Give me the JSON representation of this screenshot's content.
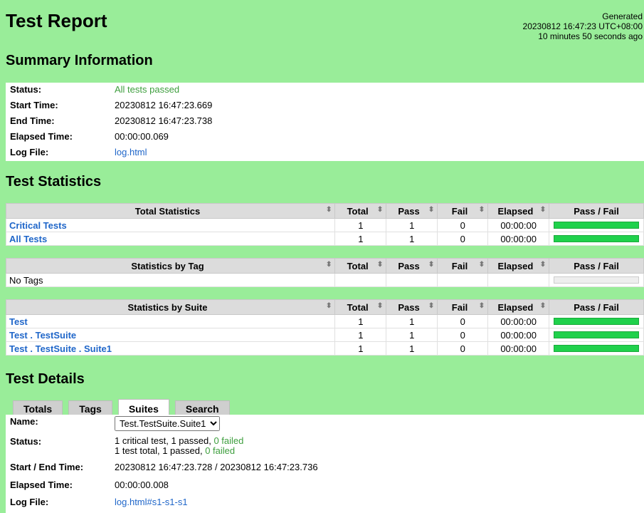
{
  "header": {
    "title": "Test Report",
    "generated_label": "Generated",
    "generated_time": "20230812 16:47:23 UTC+08:00",
    "generated_ago": "10 minutes 50 seconds ago"
  },
  "summary": {
    "heading": "Summary Information",
    "rows": [
      {
        "label": "Status:",
        "value": "All tests passed"
      },
      {
        "label": "Start Time:",
        "value": "20230812 16:47:23.669"
      },
      {
        "label": "End Time:",
        "value": "20230812 16:47:23.738"
      },
      {
        "label": "Elapsed Time:",
        "value": "00:00:00.069"
      },
      {
        "label": "Log File:",
        "value": "log.html"
      }
    ]
  },
  "statistics": {
    "heading": "Test Statistics",
    "columns": [
      "Total",
      "Pass",
      "Fail",
      "Elapsed",
      "Pass / Fail"
    ],
    "total_table": {
      "header": "Total Statistics",
      "rows": [
        {
          "name": "Critical Tests",
          "total": "1",
          "pass": "1",
          "fail": "0",
          "elapsed": "00:00:00",
          "pass_ratio": 1.0
        },
        {
          "name": "All Tests",
          "total": "1",
          "pass": "1",
          "fail": "0",
          "elapsed": "00:00:00",
          "pass_ratio": 1.0
        }
      ]
    },
    "tag_table": {
      "header": "Statistics by Tag",
      "rows": [
        {
          "name": "No Tags"
        }
      ]
    },
    "suite_table": {
      "header": "Statistics by Suite",
      "rows": [
        {
          "name": "Test",
          "total": "1",
          "pass": "1",
          "fail": "0",
          "elapsed": "00:00:00",
          "pass_ratio": 1.0
        },
        {
          "name": "Test . TestSuite",
          "total": "1",
          "pass": "1",
          "fail": "0",
          "elapsed": "00:00:00",
          "pass_ratio": 1.0
        },
        {
          "name": "Test . TestSuite . Suite1",
          "total": "1",
          "pass": "1",
          "fail": "0",
          "elapsed": "00:00:00",
          "pass_ratio": 1.0
        }
      ]
    }
  },
  "details": {
    "heading": "Test Details",
    "tabs": [
      {
        "label": "Totals",
        "active": false
      },
      {
        "label": "Tags",
        "active": false
      },
      {
        "label": "Suites",
        "active": true
      },
      {
        "label": "Search",
        "active": false
      }
    ],
    "name_label": "Name:",
    "name_selected": "Test.TestSuite.Suite1",
    "status_label": "Status:",
    "status_line1_prefix": "1 critical test, 1 passed, ",
    "status_line1_failed": "0 failed",
    "status_line2_prefix": "1 test total, 1 passed, ",
    "status_line2_failed": "0 failed",
    "time_label": "Start / End Time:",
    "time_value": "20230812 16:47:23.728 / 20230812 16:47:23.736",
    "elapsed_label": "Elapsed Time:",
    "elapsed_value": "00:00:00.008",
    "log_label": "Log File:",
    "log_value": "log.html#s1-s1-s1"
  },
  "colors": {
    "background": "#99ed99",
    "pass_bar": "#1fd14b",
    "link": "#1f66c9",
    "pass_text": "#3d9e3d"
  },
  "icons": {
    "sort": "sort-arrows-icon"
  }
}
